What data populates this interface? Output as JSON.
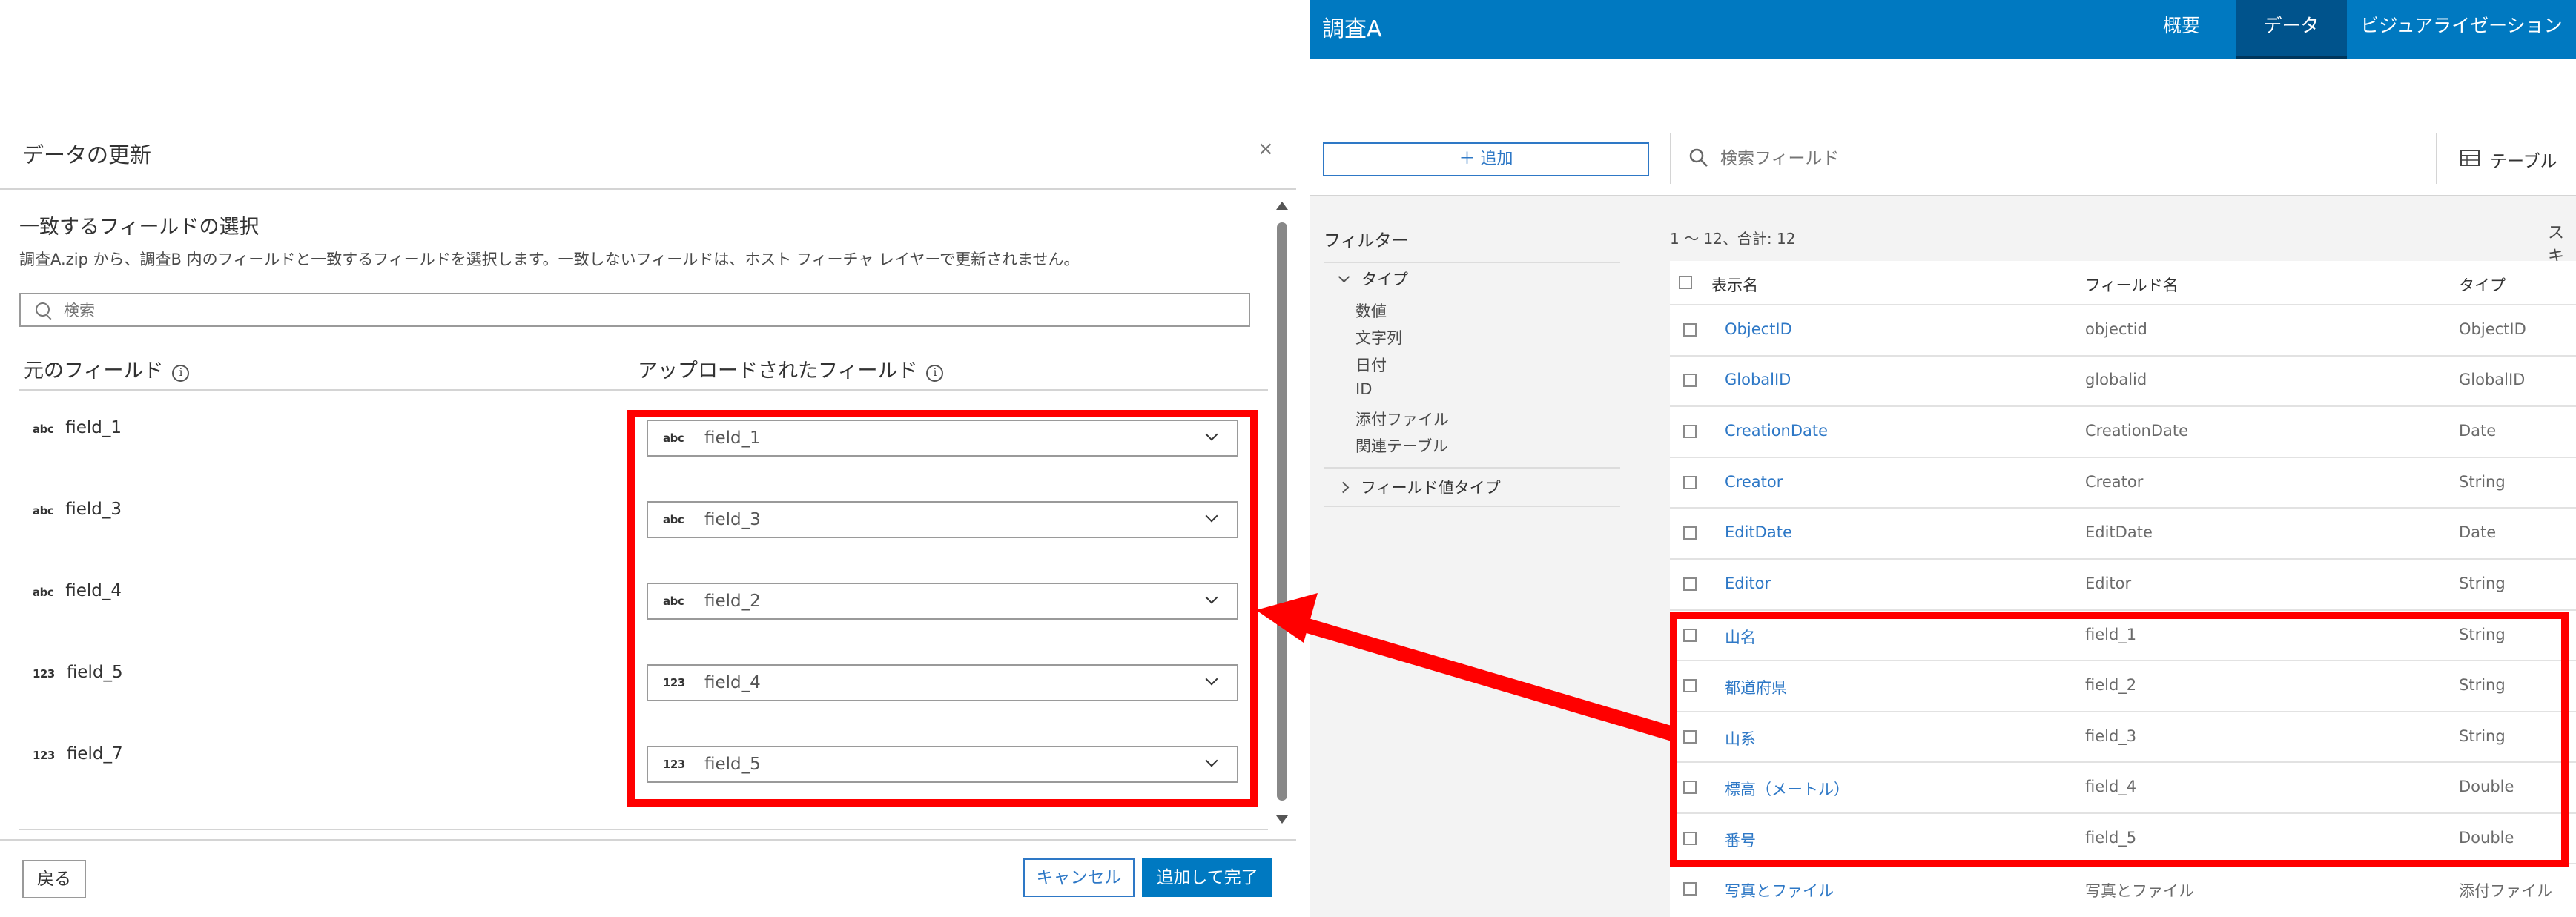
{
  "dialog": {
    "title": "データの更新",
    "close_symbol": "×",
    "section_title": "一致するフィールドの選択",
    "description": "調査A.zip から、調査B 内のフィールドと一致するフィールドを選択します。一致しないフィールドは、ホスト フィーチャ レイヤーで更新されません。",
    "search_placeholder": "検索",
    "col_source": "元のフィールド",
    "col_uploaded": "アップロードされたフィールド",
    "info_glyph": "i",
    "mappings": [
      {
        "source_type": "abc",
        "source": "field_1",
        "target_type": "abc",
        "target": "field_1"
      },
      {
        "source_type": "abc",
        "source": "field_3",
        "target_type": "abc",
        "target": "field_3"
      },
      {
        "source_type": "abc",
        "source": "field_4",
        "target_type": "abc",
        "target": "field_2"
      },
      {
        "source_type": "123",
        "source": "field_5",
        "target_type": "123",
        "target": "field_4"
      },
      {
        "source_type": "123",
        "source": "field_7",
        "target_type": "123",
        "target": "field_5"
      }
    ],
    "back_label": "戻る",
    "cancel_label": "キャンセル",
    "done_label": "追加して完了"
  },
  "app": {
    "title": "調査A",
    "tabs": [
      {
        "label": "概要",
        "active": false
      },
      {
        "label": "データ",
        "active": true
      },
      {
        "label": "ビジュアライゼーション",
        "active": false
      }
    ],
    "add_label": "＋ 追加",
    "search_placeholder": "検索フィールド",
    "view_label": "テーブル",
    "filter_title": "フィルター",
    "filter_type_group": "タイプ",
    "filter_types": [
      "数値",
      "文字列",
      "日付",
      "ID",
      "添付ファイル",
      "関連テーブル"
    ],
    "filter_value_type": "フィールド値タイプ",
    "count_text": "1 ～ 12、合計: 12",
    "right_cut_text": "スキ",
    "columns": {
      "display": "表示名",
      "field": "フィールド名",
      "type": "タイプ"
    },
    "rows": [
      {
        "display": "ObjectID",
        "field": "objectid",
        "type": "ObjectID"
      },
      {
        "display": "GlobalID",
        "field": "globalid",
        "type": "GlobalID"
      },
      {
        "display": "CreationDate",
        "field": "CreationDate",
        "type": "Date"
      },
      {
        "display": "Creator",
        "field": "Creator",
        "type": "String"
      },
      {
        "display": "EditDate",
        "field": "EditDate",
        "type": "Date"
      },
      {
        "display": "Editor",
        "field": "Editor",
        "type": "String"
      },
      {
        "display": "山名",
        "field": "field_1",
        "type": "String"
      },
      {
        "display": "都道府県",
        "field": "field_2",
        "type": "String"
      },
      {
        "display": "山系",
        "field": "field_3",
        "type": "String"
      },
      {
        "display": "標高（メートル）",
        "field": "field_4",
        "type": "Double"
      },
      {
        "display": "番号",
        "field": "field_5",
        "type": "Double"
      },
      {
        "display": "写真とファイル",
        "field": "写真とファイル",
        "type": "添付ファイル"
      }
    ]
  },
  "annotation_color": "#ff0000",
  "accent_color": "#0079c1"
}
